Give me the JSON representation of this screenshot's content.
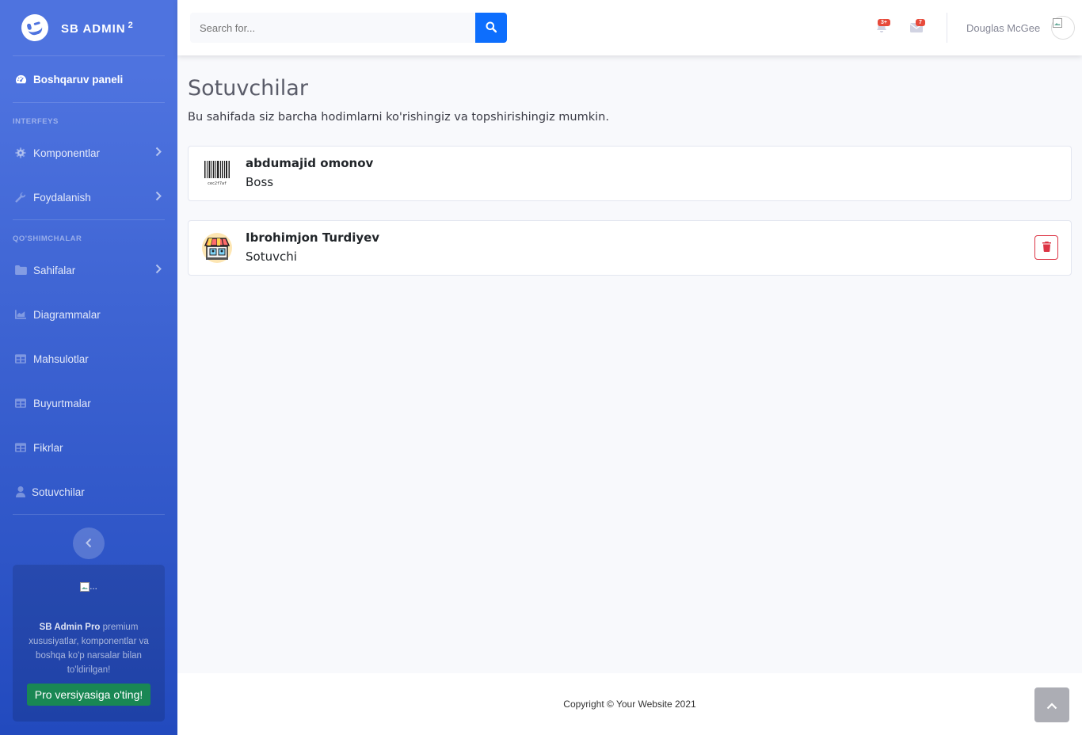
{
  "brand": {
    "name": "SB ADMIN",
    "sup": "2"
  },
  "sidebar": {
    "dashboard": "Boshqaruv paneli",
    "heading_interface": "INTERFEYS",
    "heading_addons": "QO'SHIMCHALAR",
    "items": [
      {
        "label": "Komponentlar",
        "icon": "gear-icon",
        "chevron": true
      },
      {
        "label": "Foydalanish",
        "icon": "wrench-icon",
        "chevron": true
      },
      {
        "label": "Sahifalar",
        "icon": "folder-icon",
        "chevron": true
      },
      {
        "label": "Diagrammalar",
        "icon": "area-chart-icon"
      },
      {
        "label": "Mahsulotlar",
        "icon": "table-icon"
      },
      {
        "label": "Buyurtmalar",
        "icon": "table-icon"
      },
      {
        "label": "Fikrlar",
        "icon": "table-icon"
      },
      {
        "label": "Sotuvchilar",
        "icon": "user-icon"
      }
    ],
    "promo": {
      "image_alt": "...",
      "bold": "SB Admin Pro",
      "text": " premium xususiyatlar, komponentlar va boshqa ko'p narsalar bilan to'ldirilgan!",
      "button": "Pro versiyasiga o'ting!"
    }
  },
  "topbar": {
    "search_placeholder": "Search for...",
    "alerts_badge": "3+",
    "messages_badge": "7",
    "user_name": "Douglas McGee"
  },
  "main": {
    "title": "Sotuvchilar",
    "description": "Bu sahifada siz barcha hodimlarni ko'rishingiz va topshirishingiz mumkin.",
    "sellers": [
      {
        "name": "abdumajid omonov",
        "role": "Boss",
        "barcode_text": "cec2f7af"
      },
      {
        "name": "Ibrohimjon Turdiyev",
        "role": "Sotuvchi"
      }
    ]
  },
  "footer": {
    "copyright": "Copyright © Your Website 2021"
  },
  "colors": {
    "primary": "#4e73df",
    "danger": "#dc3545",
    "success": "#198754",
    "search_button": "#0d6efd"
  }
}
